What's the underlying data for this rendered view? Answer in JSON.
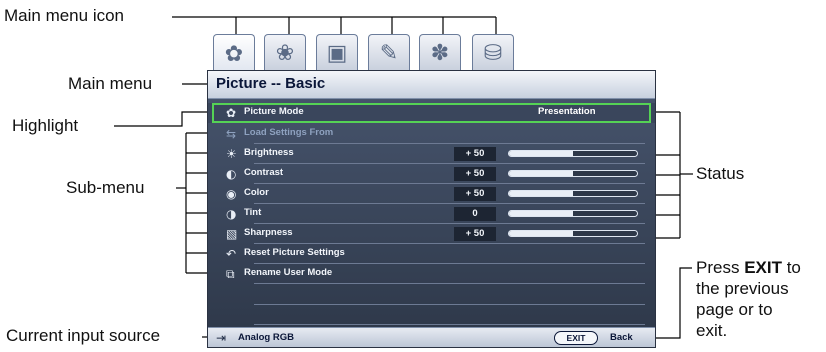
{
  "callouts": {
    "main_menu_icon": "Main menu icon",
    "main_menu": "Main menu",
    "highlight": "Highlight",
    "sub_menu": "Sub-menu",
    "status": "Status",
    "current_input_source": "Current input source",
    "press": "Press ",
    "exit": "EXIT",
    "to": " to",
    "line2": "the previous",
    "line3": "page or to",
    "line4": "exit."
  },
  "tabs": [
    {
      "icon": "picture-icon"
    },
    {
      "icon": "picture-advanced-icon"
    },
    {
      "icon": "display-icon"
    },
    {
      "icon": "settings-basic-icon"
    },
    {
      "icon": "settings-advanced-icon"
    },
    {
      "icon": "information-icon"
    }
  ],
  "osd": {
    "title": "Picture -- Basic",
    "items": [
      {
        "label": "Picture Mode",
        "icon": "picture-mode-icon",
        "status": "Presentation"
      },
      {
        "label": "Load Settings From",
        "icon": "load-settings-icon"
      },
      {
        "label": "Brightness",
        "icon": "brightness-icon",
        "value": "+ 50",
        "level": 0.5
      },
      {
        "label": "Contrast",
        "icon": "contrast-icon",
        "value": "+ 50",
        "level": 0.5
      },
      {
        "label": "Color",
        "icon": "color-icon",
        "value": "+ 50",
        "level": 0.5
      },
      {
        "label": "Tint",
        "icon": "tint-icon",
        "value": "0",
        "level": 0.5
      },
      {
        "label": "Sharpness",
        "icon": "sharpness-icon",
        "value": "+ 50",
        "level": 0.5
      },
      {
        "label": "Reset Picture Settings",
        "icon": "reset-icon"
      },
      {
        "label": "Rename User Mode",
        "icon": "rename-icon"
      }
    ],
    "footer": {
      "source": "Analog RGB",
      "exit_button": "EXIT",
      "back": "Back"
    }
  },
  "colors": {
    "highlight": "#55d255",
    "panel": "#3a465c"
  }
}
